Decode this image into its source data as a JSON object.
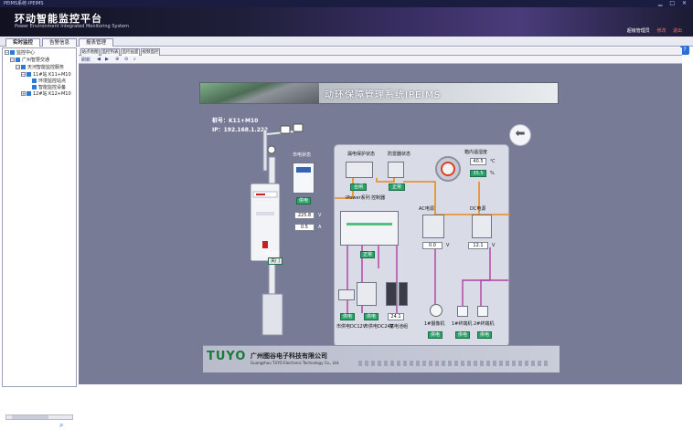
{
  "window": {
    "title": "PEIMS系统-IPEIMS"
  },
  "header": {
    "app_title": "环动智能监控平台",
    "app_subtitle": "Power Environment Integrated Monitoring System",
    "user_label": "超级管理员",
    "link_modify": "修改",
    "link_exit": "退出"
  },
  "main_tabs": [
    {
      "label": "实时监控"
    },
    {
      "label": "告警信息"
    },
    {
      "label": "报表管理"
    }
  ],
  "tree": [
    {
      "label": "监控中心"
    },
    {
      "label": "广州智慧交通"
    },
    {
      "label": "天河智能监控服务"
    },
    {
      "label": "11#站 K11+M10"
    },
    {
      "label": "环境监控站点"
    },
    {
      "label": "智能监控设备"
    },
    {
      "label": "12#站 K12+M10"
    }
  ],
  "inner_tabs": [
    {
      "label": "站点地图"
    },
    {
      "label": "监控列表"
    },
    {
      "label": "监控画面"
    },
    {
      "label": "视频监控"
    }
  ],
  "toolbar": [
    {
      "label": "刷新"
    },
    {
      "label": "◀"
    },
    {
      "label": "▶"
    },
    {
      "label": "⊕"
    },
    {
      "label": "⊖"
    },
    {
      "label": "⌕"
    }
  ],
  "canvas": {
    "banner_title": "动环保障管理系统IPEIMS",
    "station_id": "桩号：K11+M10",
    "station_ip": "IP：192.168.1.223",
    "lbl_mains": "市电状态",
    "mains_status": "供电",
    "mains_voltage": "225.8",
    "mains_current": "0.5",
    "unit_v": "V",
    "unit_a": "A",
    "lbl_door": "门磁状态",
    "door_status": "关门",
    "lbl_leakage": "漏电保护状态",
    "leakage_status": "合闸",
    "lbl_lightning": "防雷器状态",
    "lightning_status": "正常",
    "lbl_env": "箱内温湿度",
    "temperature": "40.5",
    "unit_c": "℃",
    "humidity": "35.5",
    "unit_pct": "%",
    "lbl_ipower": "IPower系列\n控制器",
    "lbl_ac": "AC电源",
    "lbl_dc": "DC电源",
    "ac_value": "0.0",
    "dc_value": "12.1",
    "ipower_status": "正常",
    "lbl_dc12": "市供电DC12V",
    "lbl_dc24": "市供电DC24V",
    "lbl_battery": "蓄电池组",
    "dc12_status": "供电",
    "dc24_status": "供电",
    "battery_value": "24.1",
    "lbl_cam1": "1#摄像机",
    "lbl_cam2": "1#终端机",
    "lbl_cam3": "2#终端机",
    "cam1_status": "供电",
    "cam2_status": "供电",
    "cam3_status": "供电",
    "company_logo": "TUYO",
    "company_cn": "广州图谷电子科技有限公司",
    "company_en": "Guangzhou TUYO Electronic Technology Co., Ltd."
  },
  "colors": {
    "canvas_bg": "#777b96",
    "status_green": "#2aa36a",
    "wire_orange": "#e98a1a",
    "wire_purple": "#b23fa3",
    "logo_green": "#1a7a3c",
    "logo_orange": "#ef7c0f"
  }
}
